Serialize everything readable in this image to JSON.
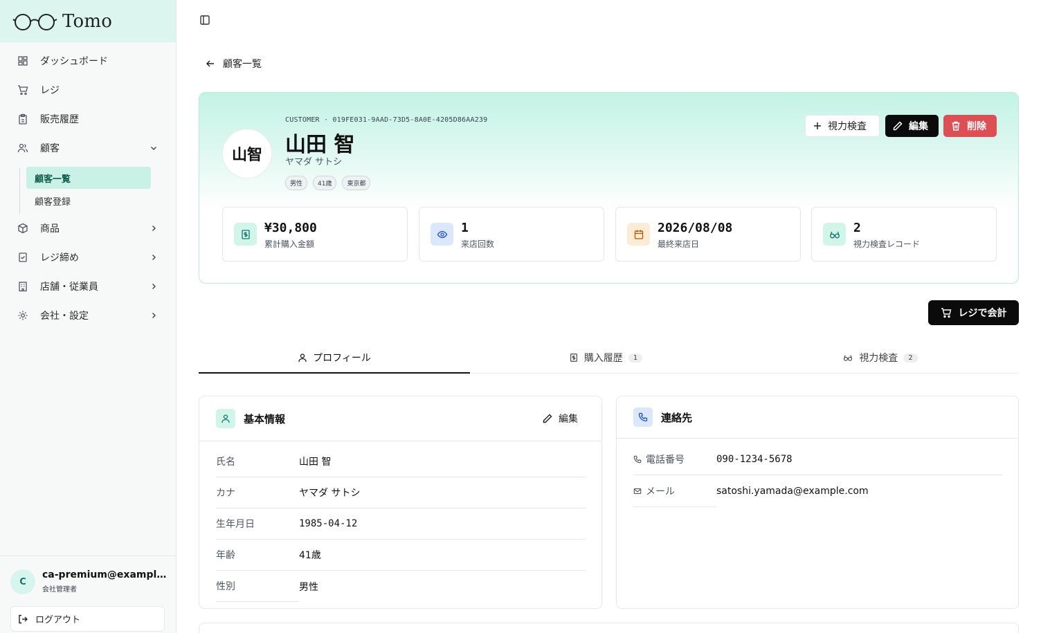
{
  "app": {
    "name": "Tomo"
  },
  "sidebar": {
    "items": [
      {
        "label": "ダッシュボード",
        "icon": "dashboard-icon"
      },
      {
        "label": "レジ",
        "icon": "cart-icon"
      },
      {
        "label": "販売履歴",
        "icon": "clipboard-icon"
      },
      {
        "label": "顧客",
        "icon": "users-icon",
        "expanded": true
      },
      {
        "label": "商品",
        "icon": "box-icon"
      },
      {
        "label": "レジ締め",
        "icon": "checklist-icon"
      },
      {
        "label": "店舗・従業員",
        "icon": "building-icon"
      },
      {
        "label": "会社・設定",
        "icon": "gear-icon"
      }
    ],
    "customer_sub": [
      {
        "label": "顧客一覧",
        "active": true
      },
      {
        "label": "顧客登録",
        "active": false
      }
    ],
    "user": {
      "initial": "C",
      "email": "ca-premium@example.com",
      "role": "会社管理者"
    },
    "logout_label": "ログアウト"
  },
  "back_label": "顧客一覧",
  "customer": {
    "id_line": "CUSTOMER · 019FE031-9AAD-73D5-8A0E-4205D86AA239",
    "avatar_text": "山智",
    "name": "山田 智",
    "kana": "ヤマダ サトシ",
    "tags": [
      "男性",
      "41歳",
      "東京都"
    ]
  },
  "actions": {
    "eye_test": "視力検査",
    "edit": "編集",
    "delete": "削除",
    "register": "レジで会計"
  },
  "stats": [
    {
      "value": "¥30,800",
      "label": "累計購入金額",
      "icon": "receipt-icon",
      "color": "#d2f5ea"
    },
    {
      "value": "1",
      "label": "来店回数",
      "icon": "eye-icon",
      "color": "#dbe8fb"
    },
    {
      "value": "2026/08/08",
      "label": "最終来店日",
      "icon": "calendar-icon",
      "color": "#fdecd5"
    },
    {
      "value": "2",
      "label": "視力検査レコード",
      "icon": "glasses-icon",
      "color": "#d2f5ea"
    }
  ],
  "tabs": [
    {
      "label": "プロフィール",
      "badge": ""
    },
    {
      "label": "購入履歴",
      "badge": "1"
    },
    {
      "label": "視力検査",
      "badge": "2"
    }
  ],
  "basic": {
    "title": "基本情報",
    "edit_label": "編集",
    "rows": [
      {
        "k": "氏名",
        "v": "山田 智"
      },
      {
        "k": "カナ",
        "v": "ヤマダ サトシ"
      },
      {
        "k": "生年月日",
        "v": "1985-04-12"
      },
      {
        "k": "年齢",
        "v": "41歳"
      },
      {
        "k": "性別",
        "v": "男性"
      }
    ]
  },
  "contact": {
    "title": "連絡先",
    "rows": [
      {
        "k": "電話番号",
        "v": "090-1234-5678"
      },
      {
        "k": "メール",
        "v": "satoshi.yamada@example.com"
      }
    ]
  },
  "colors": {
    "accent": "#c9f1e6",
    "danger": "#dc4f55",
    "dark": "#0b0b0b"
  }
}
